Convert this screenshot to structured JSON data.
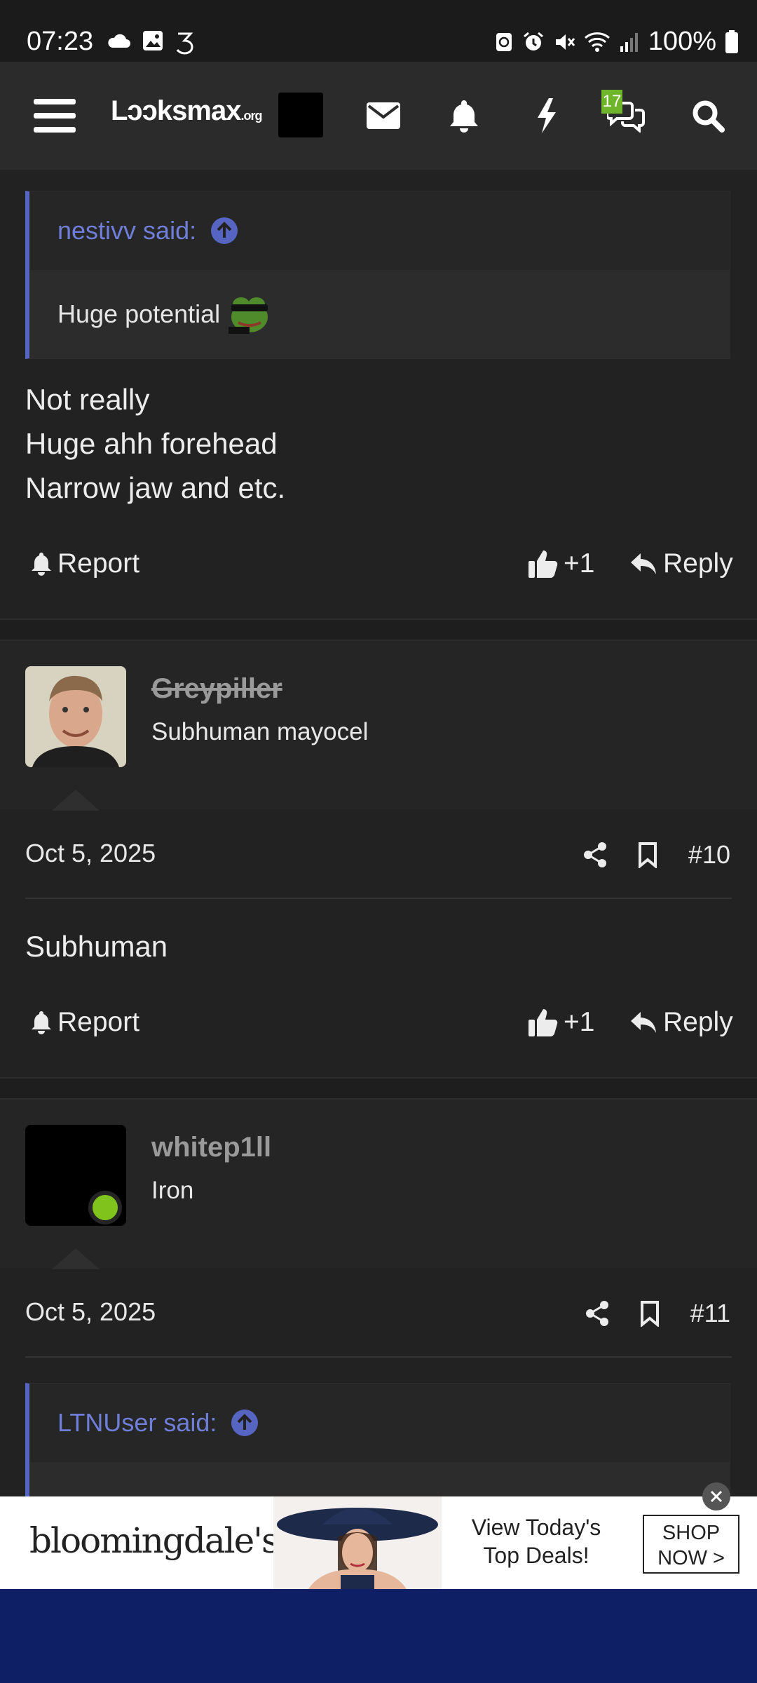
{
  "status_bar": {
    "time": "07:23",
    "battery": "100%",
    "left_icons": [
      "cloud-icon",
      "image-icon",
      "carrier-icon"
    ],
    "right_icons": [
      "nfc-icon",
      "alarm-icon",
      "mute-icon",
      "wifi-icon",
      "signal-icon",
      "battery-icon"
    ]
  },
  "header": {
    "logo_main": "Lɔɔksmax",
    "logo_suffix": ".org",
    "chat_badge": "17",
    "icons": [
      "menu-icon",
      "mail-icon",
      "bell-icon",
      "bolt-icon",
      "chat-icon",
      "search-icon"
    ]
  },
  "post9": {
    "quote_author": "nestivv said:",
    "quote_text": "Huge potential",
    "lines": [
      "Not really",
      "Huge ahh forehead",
      "Narrow jaw and etc."
    ],
    "report_label": "Report",
    "likes": "+1",
    "reply_label": "Reply"
  },
  "post10": {
    "username": "Greypiller",
    "user_title": "Subhuman mayocel",
    "date": "Oct 5, 2025",
    "number": "#10",
    "text": "Subhuman",
    "report_label": "Report",
    "likes": "+1",
    "reply_label": "Reply"
  },
  "post11": {
    "username": "whitep1ll",
    "user_title": "Iron",
    "date": "Oct 5, 2025",
    "number": "#11",
    "quote_author": "LTNUser said:"
  },
  "ad": {
    "brand": "bloomingdale's",
    "text_line1": "View Today's",
    "text_line2": "Top Deals!",
    "button_line1": "SHOP",
    "button_line2": "NOW >"
  },
  "colors": {
    "accent": "#5765c2",
    "online": "#7fc31c",
    "badge": "#6fb52c",
    "footer": "#0f1f66"
  }
}
